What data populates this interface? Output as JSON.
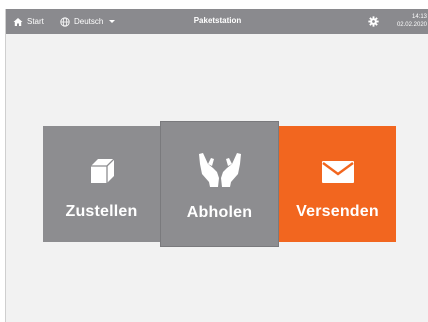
{
  "topbar": {
    "home_label": "Start",
    "language_label": "Deutsch",
    "title": "Paketstation",
    "time": "14:13",
    "date": "02.02.2020",
    "icons": {
      "home": "home-icon",
      "language": "globe-icon",
      "settings": "gear-icon"
    }
  },
  "tiles": [
    {
      "label": "Zustellen",
      "icon": "box-icon",
      "color": "#8d8d90"
    },
    {
      "label": "Abholen",
      "icon": "hands-icon",
      "color": "#8d8d90"
    },
    {
      "label": "Versenden",
      "icon": "envelope-icon",
      "color": "#f2661f"
    }
  ],
  "colors": {
    "topbar": "#8a8a8e",
    "accent": "#f2661f",
    "background": "#f2f2f2"
  }
}
